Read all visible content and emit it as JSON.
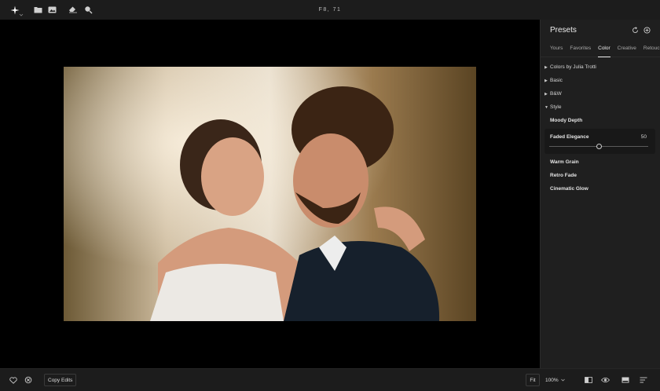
{
  "window": {
    "title": "F8, 71"
  },
  "toolbar": {
    "icons": [
      "app-logo-icon",
      "folder-icon",
      "image-icon",
      "eraser-icon",
      "search-icon"
    ]
  },
  "presets_panel": {
    "title": "Presets",
    "tabs": [
      {
        "label": "Yours",
        "active": false
      },
      {
        "label": "Favorites",
        "active": false
      },
      {
        "label": "Color",
        "active": true
      },
      {
        "label": "Creative",
        "active": false
      },
      {
        "label": "Retouch",
        "active": false
      }
    ],
    "groups": [
      {
        "label": "Colors by Julia Trotti",
        "expanded": false
      },
      {
        "label": "Basic",
        "expanded": false
      },
      {
        "label": "B&W",
        "expanded": false
      },
      {
        "label": "Style",
        "expanded": true
      }
    ],
    "style_presets": [
      {
        "label": "Moody Depth"
      },
      {
        "label": "Faded Elegance",
        "value": "50",
        "amount": 0.5,
        "selected": true
      },
      {
        "label": "Warm Grain"
      },
      {
        "label": "Retro Fade"
      },
      {
        "label": "Cinematic Glow"
      }
    ]
  },
  "bottom_bar": {
    "copy_edits_label": "Copy Edits",
    "fit_label": "Fit",
    "zoom_label": "100%"
  }
}
